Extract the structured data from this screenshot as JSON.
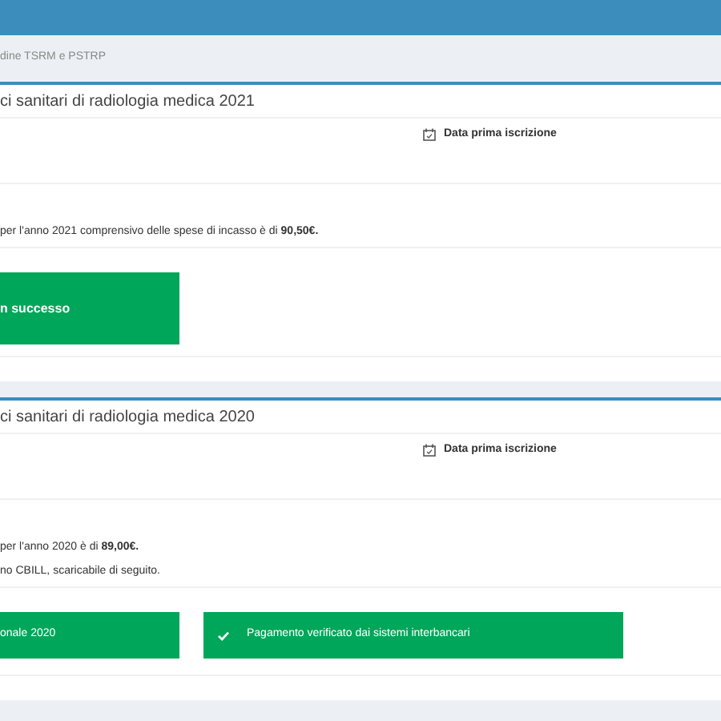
{
  "breadcrumb": "dine TSRM e PSTRP",
  "cards": [
    {
      "title": "ci sanitari di radiologia medica 2021",
      "date_label": "Data prima iscrizione",
      "lines": [
        "per l'anno 2021 comprensivo delle spese di incasso è di **90,50€.**"
      ],
      "badges": [
        {
          "kind": "bold",
          "text": "n successo"
        }
      ]
    },
    {
      "title": "ci sanitari di radiologia medica 2020",
      "date_label": "Data prima iscrizione",
      "lines": [
        "per l'anno 2020 è di **89,00€.**",
        "no CBILL, scaricabile di seguito."
      ],
      "badges": [
        {
          "kind": "plain",
          "text": "onale 2020"
        },
        {
          "kind": "check",
          "text": "Pagamento verificato dai sistemi interbancari"
        }
      ]
    }
  ]
}
